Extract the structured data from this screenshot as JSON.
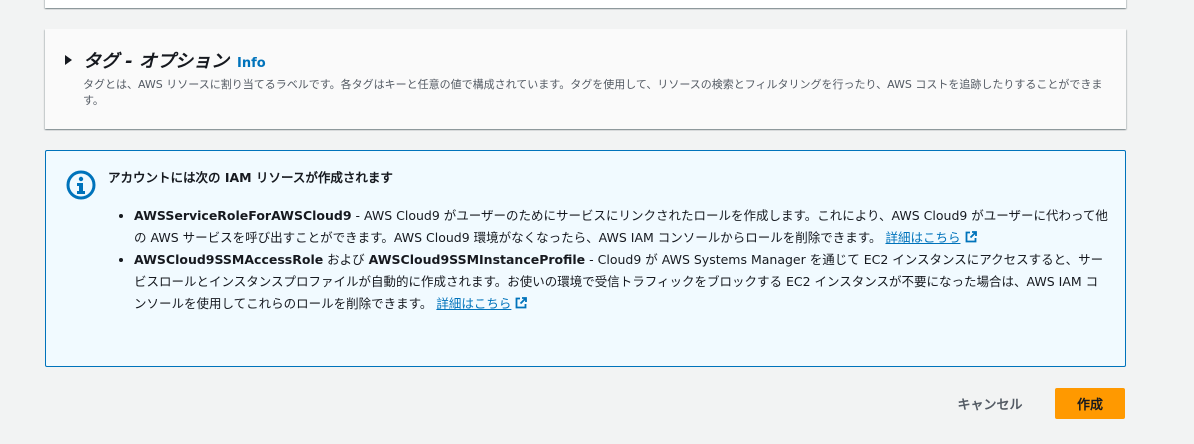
{
  "tags_section": {
    "title": "タグ - オプション",
    "info_link": "Info",
    "description": "タグとは、AWS リソースに割り当てるラベルです。各タグはキーと任意の値で構成されています。タグを使用して、リソースの検索とフィルタリングを行ったり、AWS コストを追跡したりすることができます。"
  },
  "iam_alert": {
    "title": "アカウントには次の IAM リソースが作成されます",
    "items": [
      {
        "bold1": "AWSServiceRoleForAWSCloud9",
        "text": " - AWS Cloud9 がユーザーのためにサービスにリンクされたロールを作成します。これにより、AWS Cloud9 がユーザーに代わって他の AWS サービスを呼び出すことができます。AWS Cloud9 環境がなくなったら、AWS IAM コンソールからロールを削除できます。 ",
        "link": "詳細はこちら"
      },
      {
        "bold1": "AWSCloud9SSMAccessRole",
        "mid": " および ",
        "bold2": "AWSCloud9SSMInstanceProfile",
        "text": " - Cloud9 が AWS Systems Manager を通じて EC2 インスタンスにアクセスすると、サービスロールとインスタンスプロファイルが自動的に作成されます。お使いの環境で受信トラフィックをブロックする EC2 インスタンスが不要になった場合は、AWS IAM コンソールを使用してこれらのロールを削除できます。 ",
        "link": "詳細はこちら"
      }
    ]
  },
  "actions": {
    "cancel": "キャンセル",
    "create": "作成"
  },
  "colors": {
    "accent": "#0073bb",
    "primary_button": "#ff9900",
    "alert_bg": "#f1faff"
  }
}
